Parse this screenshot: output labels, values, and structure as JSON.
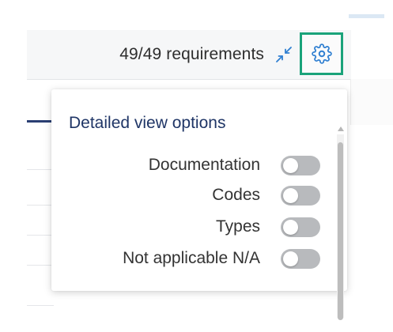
{
  "header": {
    "requirements_count": "49/49 requirements",
    "collapse_icon": "collapse-arrows-icon",
    "settings_icon": "gear-icon"
  },
  "popover": {
    "title": "Detailed view options",
    "options": [
      {
        "label": "Documentation",
        "enabled": false
      },
      {
        "label": "Codes",
        "enabled": false
      },
      {
        "label": "Types",
        "enabled": false
      },
      {
        "label": "Not applicable N/A",
        "enabled": false
      }
    ]
  },
  "colors": {
    "accent_blue": "#2f7fd1",
    "title_navy": "#1f3566",
    "focus_green": "#1aa37a",
    "toggle_off": "#b8babd"
  }
}
